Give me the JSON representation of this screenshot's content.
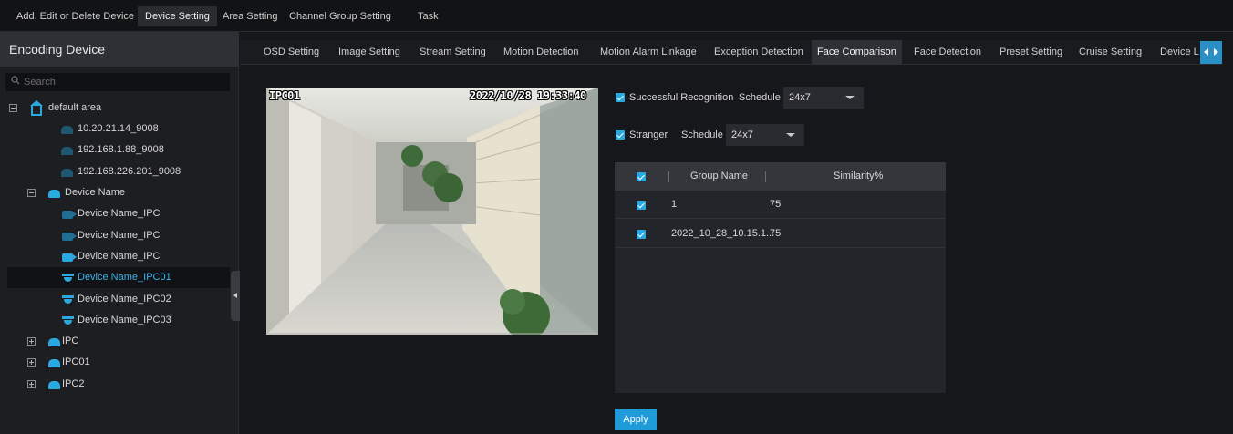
{
  "top_menu": {
    "tabs": [
      {
        "label": "Add, Edit or Delete Device",
        "active": false
      },
      {
        "label": "Device Setting",
        "active": true
      },
      {
        "label": "Area Setting",
        "active": false
      },
      {
        "label": "Channel Group Setting",
        "active": false
      },
      {
        "label": "Task",
        "active": false
      }
    ]
  },
  "sidebar": {
    "title": "Encoding Device",
    "search_placeholder": "Search",
    "tree": [
      {
        "label": "default area",
        "icon": "home-icon",
        "expanded": true
      },
      {
        "label": "10.20.21.14_9008",
        "icon": "dvr-icon"
      },
      {
        "label": "192.168.1.88_9008",
        "icon": "dvr-icon"
      },
      {
        "label": "192.168.226.201_9008",
        "icon": "dvr-icon"
      },
      {
        "label": "Device Name",
        "icon": "dvr-icon",
        "expanded": true
      },
      {
        "label": "Device Name_IPC",
        "icon": "camera-icon"
      },
      {
        "label": "Device Name_IPC",
        "icon": "camera-icon"
      },
      {
        "label": "Device Name_IPC",
        "icon": "camera-icon"
      },
      {
        "label": "Device Name_IPC01",
        "icon": "dome-camera-icon",
        "selected": true
      },
      {
        "label": "Device Name_IPC02",
        "icon": "dome-camera-icon"
      },
      {
        "label": "Device Name_IPC03",
        "icon": "dome-camera-icon"
      },
      {
        "label": "IPC",
        "icon": "dvr-icon",
        "expanded": false
      },
      {
        "label": "IPC01",
        "icon": "dvr-icon",
        "expanded": false
      },
      {
        "label": "IPC2",
        "icon": "dvr-icon",
        "expanded": false
      }
    ]
  },
  "sub_tabs": [
    {
      "label": "OSD Setting"
    },
    {
      "label": "Image Setting"
    },
    {
      "label": "Stream Setting"
    },
    {
      "label": "Motion Detection"
    },
    {
      "label": "Motion Alarm Linkage"
    },
    {
      "label": "Exception Detection"
    },
    {
      "label": "Face Comparison",
      "active": true
    },
    {
      "label": "Face Detection"
    },
    {
      "label": "Preset Setting"
    },
    {
      "label": "Cruise Setting"
    },
    {
      "label": "Device L"
    }
  ],
  "video": {
    "channel_name": "IPC01",
    "timestamp": "2022/10/28 19:33:40"
  },
  "face_comparison": {
    "successful_recognition": {
      "checked": true,
      "label": "Successful Recognition",
      "schedule_label": "Schedule",
      "schedule_value": "24x7"
    },
    "stranger": {
      "checked": true,
      "label": "Stranger",
      "schedule_label": "Schedule",
      "schedule_value": "24x7"
    },
    "table": {
      "columns": [
        "Group Name",
        "Similarity%"
      ],
      "rows": [
        {
          "checked": true,
          "group_name": "1",
          "similarity": "75"
        },
        {
          "checked": true,
          "group_name": "2022_10_28_10.15.1...",
          "similarity": "75"
        }
      ]
    },
    "apply_label": "Apply"
  },
  "colors": {
    "accent": "#2aa8e0",
    "selected_text": "#3db3ea",
    "apply_bg": "#1e9bd8"
  }
}
